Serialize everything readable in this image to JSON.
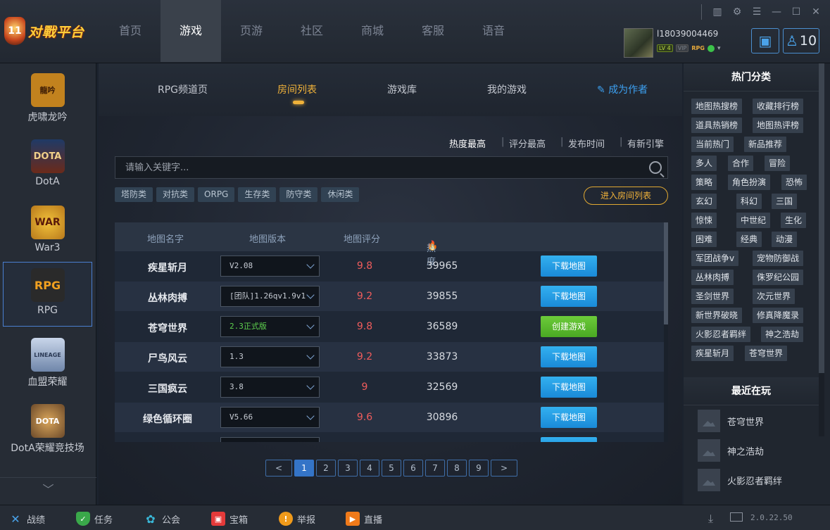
{
  "app": {
    "logo_text": "对戰平台",
    "logo_badge": "11"
  },
  "main_nav": [
    {
      "label": "首页"
    },
    {
      "label": "游戏",
      "active": true
    },
    {
      "label": "页游"
    },
    {
      "label": "社区"
    },
    {
      "label": "商城"
    },
    {
      "label": "客服"
    },
    {
      "label": "语音"
    }
  ],
  "window_controls": [
    "stats-icon",
    "settings-icon",
    "menu-icon",
    "minimize-icon",
    "maximize-icon",
    "close-icon"
  ],
  "user": {
    "name": "l18039004469",
    "level": "LV 4",
    "vip": "VIP",
    "rpg": "RPG",
    "friend_count": "10"
  },
  "sidebar": {
    "games": [
      {
        "label": "虎啸龙吟",
        "icon": "三国\n龙吟",
        "color": "#c2821e"
      },
      {
        "label": "DotA",
        "icon": "DOTA",
        "color": "#6b2a1a"
      },
      {
        "label": "War3",
        "icon": "WAR",
        "color": "#b8791c"
      },
      {
        "label": "RPG",
        "icon": "RPG",
        "color": "#3d3d3d",
        "active": true
      },
      {
        "label": "血盟荣耀",
        "icon": "LINEAGE",
        "color": "#8fa3c5"
      },
      {
        "label": "DotA荣耀竞技场",
        "icon": "DOTA",
        "color": "#6c4a2a"
      }
    ]
  },
  "sub_nav": {
    "channel": "RPG频道页",
    "rooms": "房间列表",
    "library": "游戏库",
    "mine": "我的游戏",
    "author": "成为作者"
  },
  "sort": {
    "hot": "热度最高",
    "rating": "评分最高",
    "time": "发布时间",
    "engine": "有新引擎"
  },
  "search": {
    "placeholder": "请输入关键字..."
  },
  "tags": [
    "塔防类",
    "对抗类",
    "ORPG",
    "生存类",
    "防守类",
    "休闲类"
  ],
  "enter_room_label": "进入房间列表",
  "table": {
    "headers": {
      "name": "地图名字",
      "version": "地图版本",
      "rating": "地图评分",
      "heat": "热度"
    },
    "rows": [
      {
        "name": "疾星斩月",
        "version": "V2.08",
        "score": "9.8",
        "heat": "39965",
        "action": "下载地图"
      },
      {
        "name": "丛林肉搏",
        "version": "[团队]1.26qv1.9v1",
        "score": "9.2",
        "heat": "39855",
        "action": "下载地图"
      },
      {
        "name": "苍穹世界",
        "version": "2.3正式版",
        "score": "9.8",
        "heat": "36589",
        "action": "创建游戏",
        "green": true
      },
      {
        "name": "尸鸟风云",
        "version": "1.3",
        "score": "9.2",
        "heat": "33873",
        "action": "下载地图"
      },
      {
        "name": "三国疯云",
        "version": "3.8",
        "score": "9",
        "heat": "32569",
        "action": "下载地图"
      },
      {
        "name": "绿色循环圈",
        "version": "V5.66",
        "score": "9.6",
        "heat": "30896",
        "action": "下载地图"
      }
    ]
  },
  "pager": {
    "prev": "<",
    "next": ">",
    "pages": [
      "1",
      "2",
      "3",
      "4",
      "5",
      "6",
      "7",
      "8",
      "9"
    ],
    "current": "1"
  },
  "hot_categories": {
    "title": "热门分类",
    "items": [
      "地图热搜榜",
      "收藏排行榜",
      "道具热销榜",
      "地图热评榜",
      "当前热门",
      "新品推荐",
      "多人",
      "合作",
      "冒险",
      "策略",
      "角色扮演",
      "恐怖",
      "玄幻",
      "科幻",
      "三国",
      "惊悚",
      "中世纪",
      "生化",
      "困难",
      "经典",
      "动漫",
      "军团战争v",
      "宠物防御战",
      "丛林肉搏",
      "侏罗纪公园",
      "圣剑世界",
      "次元世界",
      "新世界破晓",
      "修真降魔录",
      "火影忍者羁绊",
      "神之浩劫",
      "疾星斩月",
      "苍穹世界"
    ]
  },
  "recent": {
    "title": "最近在玩",
    "items": [
      "苍穹世界",
      "神之浩劫",
      "火影忍者羁绊"
    ]
  },
  "bottom": {
    "items": [
      {
        "label": "战绩",
        "icon": "trophy-icon"
      },
      {
        "label": "任务",
        "icon": "shield-icon"
      },
      {
        "label": "公会",
        "icon": "paw-icon"
      },
      {
        "label": "宝箱",
        "icon": "gift-icon"
      },
      {
        "label": "举报",
        "icon": "warning-icon"
      },
      {
        "label": "直播",
        "icon": "tv-icon"
      }
    ],
    "version": "2.0.22.50"
  }
}
